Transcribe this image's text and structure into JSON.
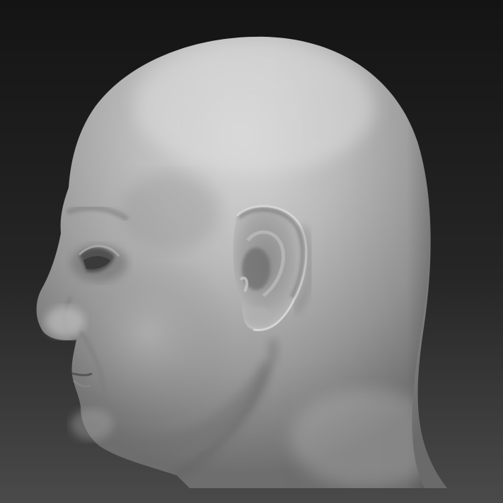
{
  "viewport": {
    "background_top": "#141414",
    "background_bottom": "#4a4a4a",
    "material_light": "#cfcfcf",
    "material_mid": "#9a9a9a",
    "material_shadow": "#4f4f4f"
  },
  "model": {
    "subject": "sculpted-head-profile",
    "view": "left-side-profile"
  }
}
